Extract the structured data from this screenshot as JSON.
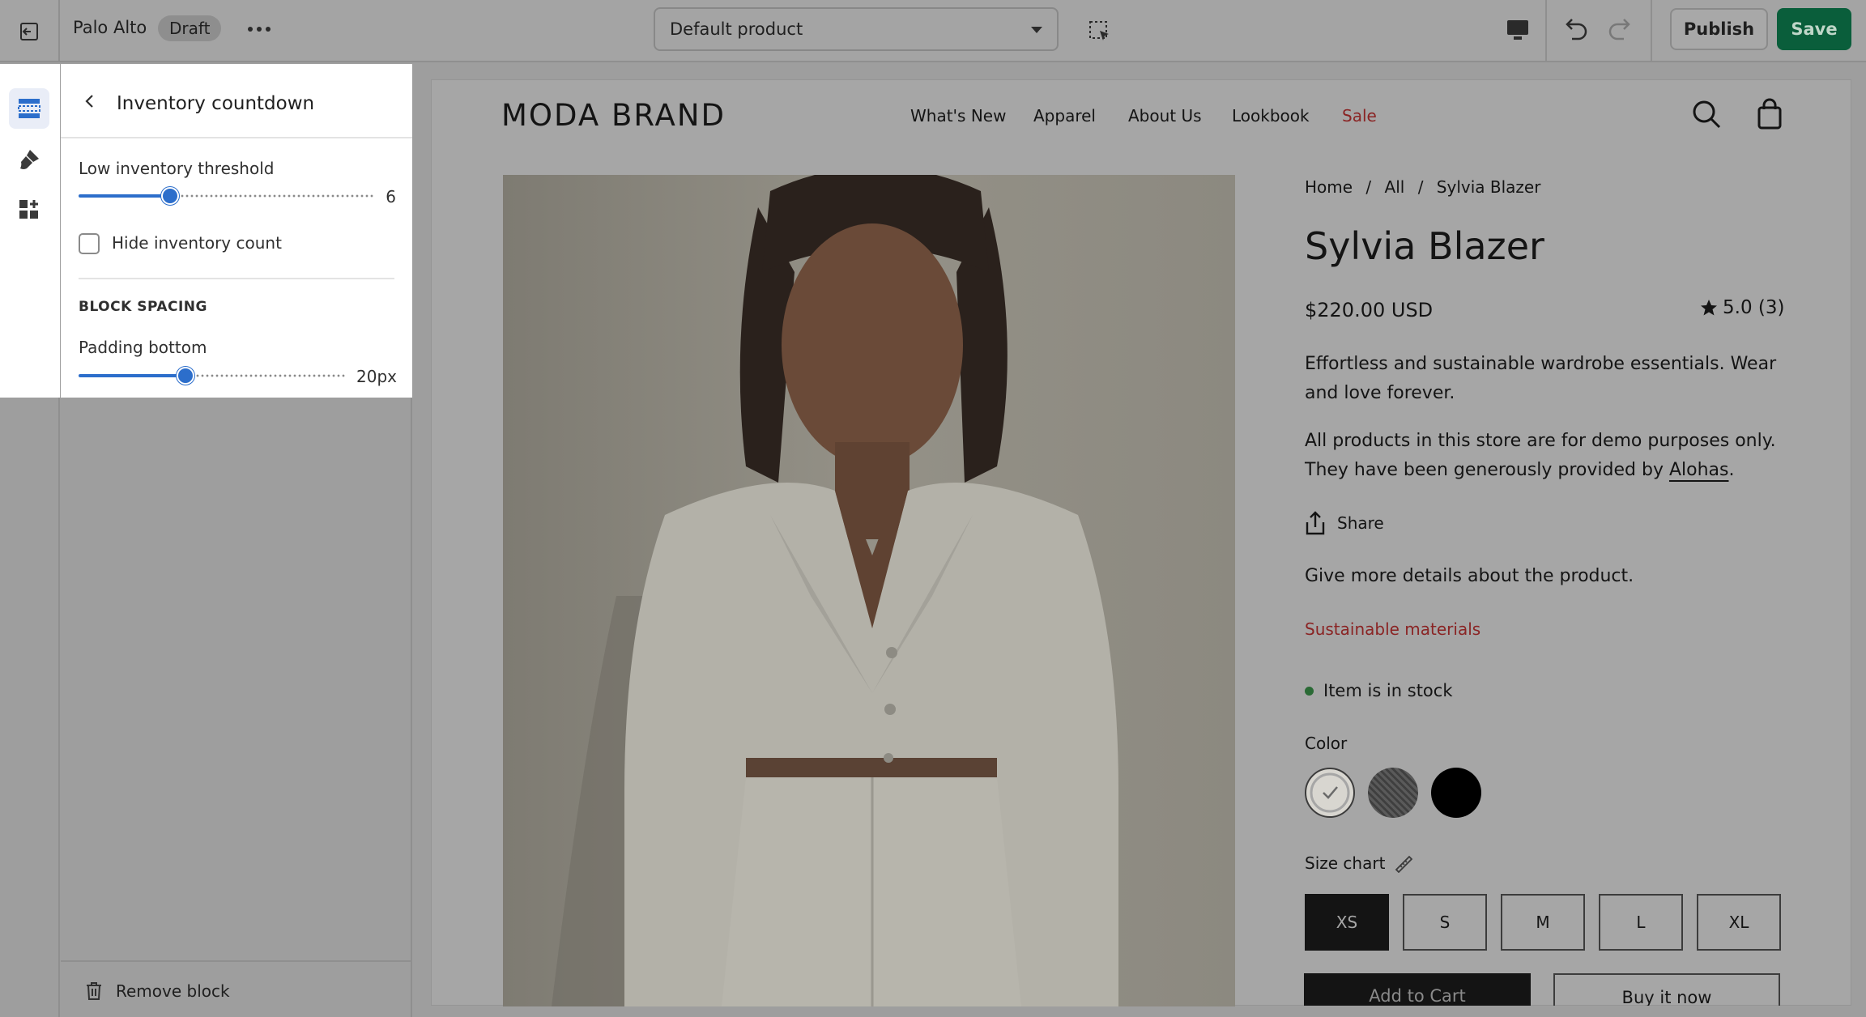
{
  "topbar": {
    "store_name": "Palo Alto",
    "status_badge": "Draft",
    "template_select": "Default product",
    "publish_label": "Publish",
    "save_label": "Save"
  },
  "panel": {
    "title": "Inventory countdown",
    "threshold_label": "Low inventory threshold",
    "threshold_value": "6",
    "threshold_fraction": 0.31,
    "hide_count_label": "Hide inventory count",
    "hide_count_checked": false,
    "section_heading": "BLOCK SPACING",
    "padding_label": "Padding bottom",
    "padding_value": "20px",
    "padding_fraction": 0.4,
    "remove_label": "Remove block"
  },
  "store": {
    "brand": "MODA BRAND",
    "nav": [
      "What's New",
      "Apparel",
      "About Us",
      "Lookbook",
      "Sale"
    ]
  },
  "product": {
    "breadcrumb": [
      "Home",
      "/",
      "All",
      "/",
      "Sylvia Blazer"
    ],
    "title": "Sylvia Blazer",
    "price": "$220.00 USD",
    "rating": "5.0 (3)",
    "desc1": "Effortless and sustainable wardrobe essentials. Wear and love forever.",
    "desc2_prefix": "All products in this store are for demo purposes only. They have been generously provided by ",
    "desc2_link": "Alohas",
    "desc2_suffix": ".",
    "share_label": "Share",
    "more_details": "Give more details about the product.",
    "sustainable": "Sustainable materials",
    "stock": "Item is in stock",
    "color_label": "Color",
    "colors": [
      "#d8d6d0",
      "#5a5a5a",
      "#000000"
    ],
    "size_chart_label": "Size chart",
    "sizes": [
      "XS",
      "S",
      "M",
      "L",
      "XL"
    ],
    "selected_size": "XS",
    "add_to_cart": "Add to Cart",
    "buy_now": "Buy it now"
  },
  "colors": {
    "accent": "#2c6ecb",
    "save_green": "#0a5e3b",
    "sale_red": "#8a2424",
    "stock_green": "#2a6a35"
  }
}
